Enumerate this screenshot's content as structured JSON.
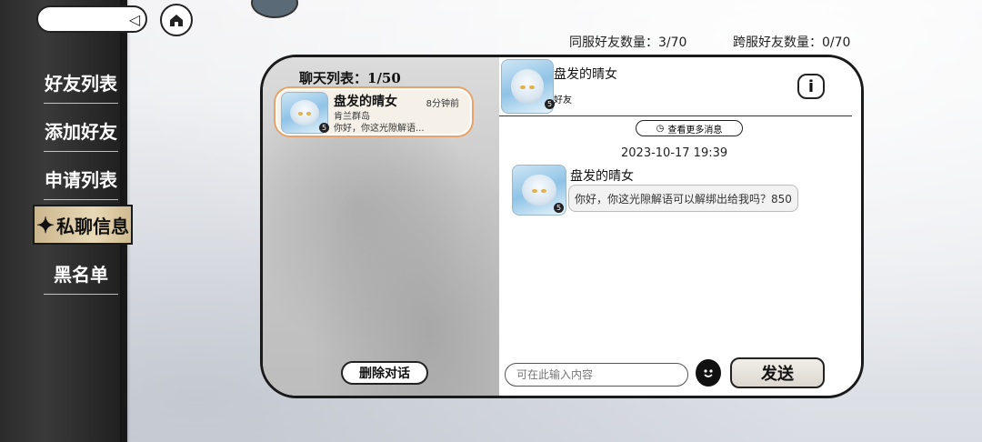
{
  "sidebar": {
    "items": [
      {
        "label": "好友列表"
      },
      {
        "label": "添加好友"
      },
      {
        "label": "申请列表"
      },
      {
        "label": "私聊信息",
        "active": true,
        "icon": "four-point-star-icon"
      },
      {
        "label": "黑名单"
      }
    ]
  },
  "top": {
    "same_server_label": "同服好友数量：3/70",
    "cross_server_label": "跨服好友数量：0/70",
    "home_icon": "home-icon",
    "search_icon": "arrow-left-icon"
  },
  "chat_list": {
    "title": "聊天列表：1/50",
    "items": [
      {
        "name": "盘发的晴女",
        "time": "8分钟前",
        "server": "肯兰群岛",
        "preview": "你好，你这光隙解语...",
        "level": "5"
      }
    ],
    "delete_label": "删除对话"
  },
  "conversation": {
    "name": "盘发的晴女",
    "relation": "好友",
    "level": "5",
    "more_label": "查看更多消息",
    "messages": [
      {
        "timestamp": "2023-10-17 19:39",
        "sender": "盘发的晴女",
        "text": "你好，你这光隙解语可以解绑出给我吗？850",
        "level": "5"
      }
    ],
    "input_placeholder": "可在此输入内容",
    "send_label": "发送",
    "info_icon": "info-icon",
    "emoji_icon": "emoji-icon"
  },
  "colors": {
    "sidebar_bg": "#2b2b2b",
    "active_tab": "#e8d9b6",
    "card_border": "#e7a36a"
  }
}
